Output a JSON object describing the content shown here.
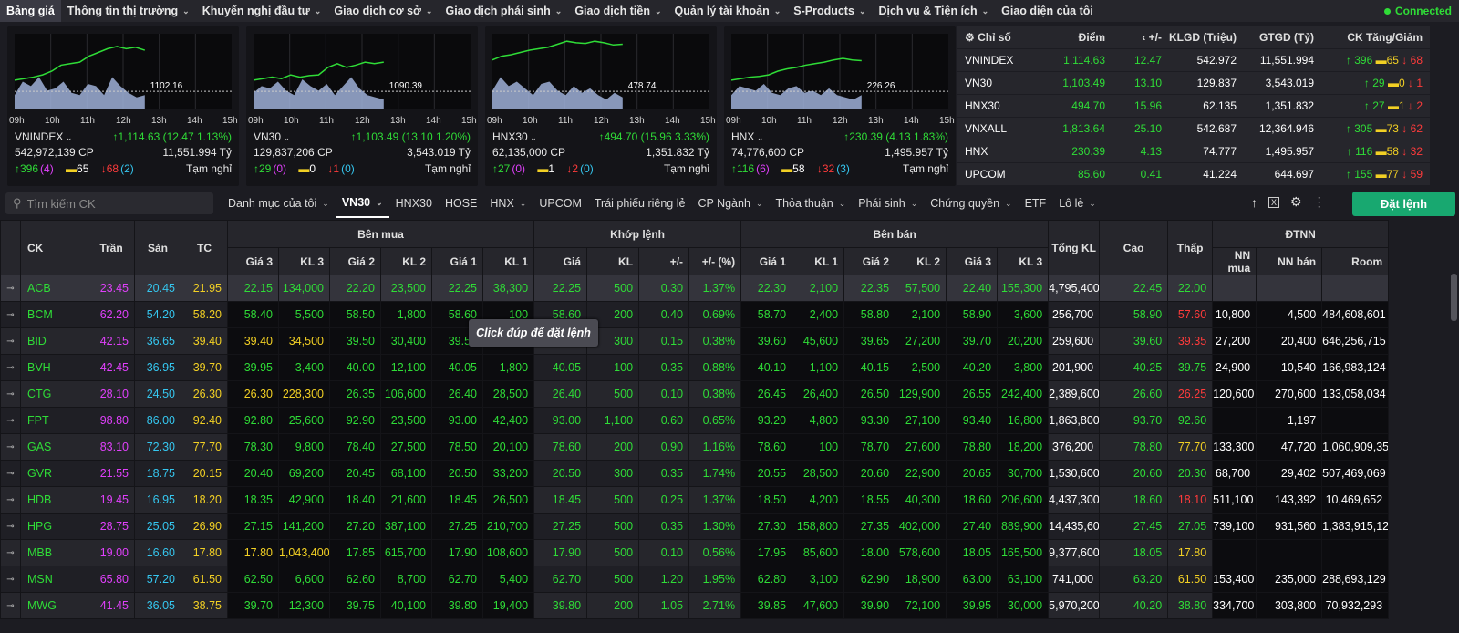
{
  "nav": {
    "items": [
      "Bảng giá",
      "Thông tin thị trường",
      "Khuyến nghị đầu tư",
      "Giao dịch cơ sở",
      "Giao dịch phái sinh",
      "Giao dịch tiền",
      "Quản lý tài khoản",
      "S-Products",
      "Dịch vụ & Tiện ích",
      "Giao diện của tôi"
    ],
    "connection": "Connected"
  },
  "index_panels": [
    {
      "name": "VNINDEX",
      "volume": "542,972,139 CP",
      "change": "1,114.63 (12.47 1.13%)",
      "value": "11,551.994 Tỷ",
      "up": "396",
      "upc": "(4)",
      "ref": "65",
      "down": "68",
      "downc": "(2)",
      "status": "Tạm nghỉ",
      "refline": "1102.16",
      "hours": [
        "09h",
        "10h",
        "11h",
        "12h",
        "13h",
        "14h",
        "15h"
      ],
      "price_trace": [
        0.62,
        0.6,
        0.58,
        0.55,
        0.5,
        0.42,
        0.4,
        0.38,
        0.3,
        0.25,
        0.2,
        0.17,
        0.2,
        0.18,
        0.22
      ],
      "vol_trace": [
        0.3,
        0.6,
        0.5,
        0.7,
        0.4,
        0.45,
        0.6,
        0.35,
        0.3,
        0.55,
        0.5,
        0.3,
        0.7,
        0.5,
        0.35,
        0.25,
        0.3
      ]
    },
    {
      "name": "VN30",
      "volume": "129,837,206 CP",
      "change": "1,103.49 (13.10 1.20%)",
      "value": "3,543.019 Tỷ",
      "up": "29",
      "upc": "(0)",
      "ref": "0",
      "down": "1",
      "downc": "(0)",
      "status": "Tạm nghỉ",
      "refline": "1090.39",
      "hours": [
        "09h",
        "10h",
        "11h",
        "12h",
        "13h",
        "14h",
        "15h"
      ],
      "price_trace": [
        0.62,
        0.6,
        0.58,
        0.6,
        0.55,
        0.58,
        0.56,
        0.55,
        0.45,
        0.4,
        0.45,
        0.42,
        0.38,
        0.4,
        0.38
      ],
      "vol_trace": [
        0.35,
        0.5,
        0.45,
        0.6,
        0.4,
        0.3,
        0.65,
        0.5,
        0.4,
        0.55,
        0.3,
        0.5,
        0.7,
        0.45,
        0.3,
        0.25,
        0.2
      ]
    },
    {
      "name": "HNX30",
      "volume": "62,135,000 CP",
      "change": "494.70 (15.96 3.33%)",
      "value": "1,351.832 Tỷ",
      "up": "27",
      "upc": "(0)",
      "ref": "1",
      "down": "2",
      "downc": "(0)",
      "status": "Tạm nghỉ",
      "refline": "478.74",
      "hours": [
        "09h",
        "10h",
        "11h",
        "12h",
        "13h",
        "14h",
        "15h"
      ],
      "price_trace": [
        0.35,
        0.3,
        0.28,
        0.25,
        0.22,
        0.2,
        0.18,
        0.14,
        0.1,
        0.12,
        0.13,
        0.1,
        0.12,
        0.15,
        0.14
      ],
      "vol_trace": [
        0.4,
        0.7,
        0.5,
        0.6,
        0.45,
        0.3,
        0.55,
        0.6,
        0.4,
        0.3,
        0.5,
        0.35,
        0.45,
        0.3,
        0.2,
        0.35,
        0.25
      ]
    },
    {
      "name": "HNX",
      "volume": "74,776,600 CP",
      "change": "230.39 (4.13 1.83%)",
      "value": "1,495.957 Tỷ",
      "up": "116",
      "upc": "(6)",
      "ref": "58",
      "down": "32",
      "downc": "(3)",
      "status": "Tạm nghỉ",
      "refline": "226.26",
      "hours": [
        "09h",
        "10h",
        "11h",
        "12h",
        "13h",
        "14h",
        "15h"
      ],
      "price_trace": [
        0.62,
        0.6,
        0.58,
        0.57,
        0.55,
        0.5,
        0.47,
        0.45,
        0.42,
        0.4,
        0.38,
        0.35,
        0.33,
        0.35,
        0.36
      ],
      "vol_trace": [
        0.3,
        0.5,
        0.45,
        0.4,
        0.55,
        0.35,
        0.3,
        0.45,
        0.5,
        0.35,
        0.4,
        0.3,
        0.45,
        0.3,
        0.25,
        0.2,
        0.3
      ]
    }
  ],
  "index_table": {
    "headers": [
      "Chỉ số",
      "Điểm",
      "+/-",
      "KLGD (Triệu)",
      "GTGD (Tỷ)",
      "CK Tăng/Giảm"
    ],
    "rows": [
      [
        "VNINDEX",
        "1,114.63",
        "12.47",
        "542.972",
        "11,551.994",
        "396",
        "65",
        "68"
      ],
      [
        "VN30",
        "1,103.49",
        "13.10",
        "129.837",
        "3,543.019",
        "29",
        "0",
        "1"
      ],
      [
        "HNX30",
        "494.70",
        "15.96",
        "62.135",
        "1,351.832",
        "27",
        "1",
        "2"
      ],
      [
        "VNXALL",
        "1,813.64",
        "25.10",
        "542.687",
        "12,364.946",
        "305",
        "73",
        "62"
      ],
      [
        "HNX",
        "230.39",
        "4.13",
        "74.777",
        "1,495.957",
        "116",
        "58",
        "32"
      ],
      [
        "UPCOM",
        "85.60",
        "0.41",
        "41.224",
        "644.697",
        "155",
        "77",
        "59"
      ]
    ]
  },
  "search": {
    "placeholder": "Tìm kiếm CK"
  },
  "tabs": [
    "Danh mục của tôi",
    "VN30",
    "HNX30",
    "HOSE",
    "HNX",
    "UPCOM",
    "Trái phiếu riêng lẻ",
    "CP Ngành",
    "Thỏa thuận",
    "Phái sinh",
    "Chứng quyền",
    "ETF",
    "Lô lẻ"
  ],
  "order_button": "Đặt lệnh",
  "tooltip": "Click đúp để đặt lệnh",
  "board": {
    "group_headers": [
      "CK",
      "Trần",
      "Sàn",
      "TC",
      "Bên mua",
      "Khớp lệnh",
      "Bên bán",
      "Tổng KL",
      "Cao",
      "Thấp",
      "ĐTNN"
    ],
    "sub_headers": [
      "Giá 3",
      "KL 3",
      "Giá 2",
      "KL 2",
      "Giá 1",
      "KL 1",
      "Giá",
      "KL",
      "+/-",
      "+/- (%)",
      "Giá 1",
      "KL 1",
      "Giá 2",
      "KL 2",
      "Giá 3",
      "KL 3",
      "NN mua",
      "NN bán",
      "Room"
    ],
    "rows": [
      [
        "ACB",
        "23.45",
        "20.45",
        "21.95",
        "22.15",
        "134,000",
        "22.20",
        "23,500",
        "22.25",
        "38,300",
        "22.25",
        "500",
        "0.30",
        "1.37%",
        "22.30",
        "2,100",
        "22.35",
        "57,500",
        "22.40",
        "155,300",
        "4,795,400",
        "22.45",
        "22.00",
        "",
        "",
        ""
      ],
      [
        "BCM",
        "62.20",
        "54.20",
        "58.20",
        "58.40",
        "5,500",
        "58.50",
        "1,800",
        "58.60",
        "100",
        "58.60",
        "200",
        "0.40",
        "0.69%",
        "58.70",
        "2,400",
        "58.80",
        "2,100",
        "58.90",
        "3,600",
        "256,700",
        "58.90",
        "57.60",
        "10,800",
        "4,500",
        "484,608,601"
      ],
      [
        "BID",
        "42.15",
        "36.65",
        "39.40",
        "39.40",
        "34,500",
        "39.50",
        "30,400",
        "39.55",
        "1,300",
        "39.55",
        "300",
        "0.15",
        "0.38%",
        "39.60",
        "45,600",
        "39.65",
        "27,200",
        "39.70",
        "20,200",
        "259,600",
        "39.60",
        "39.35",
        "27,200",
        "20,400",
        "646,256,715"
      ],
      [
        "BVH",
        "42.45",
        "36.95",
        "39.70",
        "39.95",
        "3,400",
        "40.00",
        "12,100",
        "40.05",
        "1,800",
        "40.05",
        "100",
        "0.35",
        "0.88%",
        "40.10",
        "1,100",
        "40.15",
        "2,500",
        "40.20",
        "3,800",
        "201,900",
        "40.25",
        "39.75",
        "24,900",
        "10,540",
        "166,983,124"
      ],
      [
        "CTG",
        "28.10",
        "24.50",
        "26.30",
        "26.30",
        "228,300",
        "26.35",
        "106,600",
        "26.40",
        "28,500",
        "26.40",
        "500",
        "0.10",
        "0.38%",
        "26.45",
        "26,400",
        "26.50",
        "129,900",
        "26.55",
        "242,400",
        "2,389,600",
        "26.60",
        "26.25",
        "120,600",
        "270,600",
        "133,058,034"
      ],
      [
        "FPT",
        "98.80",
        "86.00",
        "92.40",
        "92.80",
        "25,600",
        "92.90",
        "23,500",
        "93.00",
        "42,400",
        "93.00",
        "1,100",
        "0.60",
        "0.65%",
        "93.20",
        "4,800",
        "93.30",
        "27,100",
        "93.40",
        "16,800",
        "1,863,800",
        "93.70",
        "92.60",
        "",
        "1,197",
        ""
      ],
      [
        "GAS",
        "83.10",
        "72.30",
        "77.70",
        "78.30",
        "9,800",
        "78.40",
        "27,500",
        "78.50",
        "20,100",
        "78.60",
        "200",
        "0.90",
        "1.16%",
        "78.60",
        "100",
        "78.70",
        "27,600",
        "78.80",
        "18,200",
        "376,200",
        "78.80",
        "77.70",
        "133,300",
        "47,720",
        "1,060,909,354"
      ],
      [
        "GVR",
        "21.55",
        "18.75",
        "20.15",
        "20.40",
        "69,200",
        "20.45",
        "68,100",
        "20.50",
        "33,200",
        "20.50",
        "300",
        "0.35",
        "1.74%",
        "20.55",
        "28,500",
        "20.60",
        "22,900",
        "20.65",
        "30,700",
        "1,530,600",
        "20.60",
        "20.30",
        "68,700",
        "29,402",
        "507,469,069"
      ],
      [
        "HDB",
        "19.45",
        "16.95",
        "18.20",
        "18.35",
        "42,900",
        "18.40",
        "21,600",
        "18.45",
        "26,500",
        "18.45",
        "500",
        "0.25",
        "1.37%",
        "18.50",
        "4,200",
        "18.55",
        "40,300",
        "18.60",
        "206,600",
        "4,437,300",
        "18.60",
        "18.10",
        "511,100",
        "143,392",
        "10,469,652"
      ],
      [
        "HPG",
        "28.75",
        "25.05",
        "26.90",
        "27.15",
        "141,200",
        "27.20",
        "387,100",
        "27.25",
        "210,700",
        "27.25",
        "500",
        "0.35",
        "1.30%",
        "27.30",
        "158,800",
        "27.35",
        "402,000",
        "27.40",
        "889,900",
        "14,435,600",
        "27.45",
        "27.05",
        "739,100",
        "931,560",
        "1,383,915,129"
      ],
      [
        "MBB",
        "19.00",
        "16.60",
        "17.80",
        "17.80",
        "1,043,400",
        "17.85",
        "615,700",
        "17.90",
        "108,600",
        "17.90",
        "500",
        "0.10",
        "0.56%",
        "17.95",
        "85,600",
        "18.00",
        "578,600",
        "18.05",
        "165,500",
        "9,377,600",
        "18.05",
        "17.80",
        "",
        "",
        ""
      ],
      [
        "MSN",
        "65.80",
        "57.20",
        "61.50",
        "62.50",
        "6,600",
        "62.60",
        "8,700",
        "62.70",
        "5,400",
        "62.70",
        "500",
        "1.20",
        "1.95%",
        "62.80",
        "3,100",
        "62.90",
        "18,900",
        "63.00",
        "63,100",
        "741,000",
        "63.20",
        "61.50",
        "153,400",
        "235,000",
        "288,693,129"
      ],
      [
        "MWG",
        "41.45",
        "36.05",
        "38.75",
        "39.70",
        "12,300",
        "39.75",
        "40,100",
        "39.80",
        "19,400",
        "39.80",
        "200",
        "1.05",
        "2.71%",
        "39.85",
        "47,600",
        "39.90",
        "72,100",
        "39.95",
        "30,000",
        "5,970,200",
        "40.20",
        "38.80",
        "334,700",
        "303,800",
        "70,932,293"
      ]
    ]
  },
  "colors": {
    "up": "#2fdc37",
    "down": "#ff3b3b",
    "ref": "#f2d024",
    "ceil": "#e040fb",
    "floor": "#35c7f0",
    "order_button": "#18a870"
  }
}
